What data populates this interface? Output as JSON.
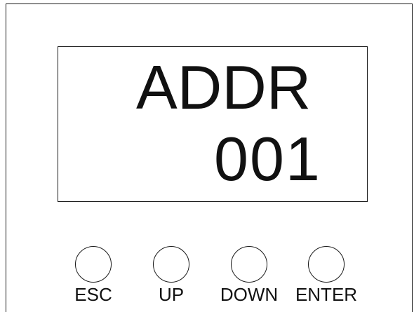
{
  "display": {
    "mode": "ADDR",
    "value": "001"
  },
  "buttons": [
    {
      "label": "ESC"
    },
    {
      "label": "UP"
    },
    {
      "label": "DOWN"
    },
    {
      "label": "ENTER"
    }
  ]
}
